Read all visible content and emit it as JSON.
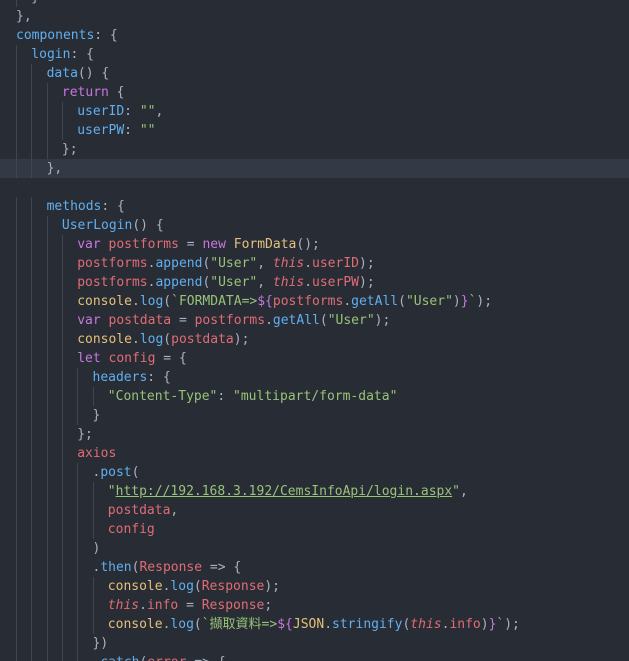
{
  "editor": {
    "lines": [
      {
        "indent": 1,
        "tokens": [
          [
            "punc",
            "}"
          ]
        ]
      },
      {
        "indent": 0,
        "tokens": [
          [
            "punc",
            "},"
          ]
        ]
      },
      {
        "indent": 0,
        "tokens": [
          [
            "prop",
            "components"
          ],
          [
            "punc",
            ": {"
          ]
        ]
      },
      {
        "indent": 1,
        "tokens": [
          [
            "prop",
            "login"
          ],
          [
            "punc",
            ": {"
          ]
        ]
      },
      {
        "indent": 2,
        "tokens": [
          [
            "fn",
            "data"
          ],
          [
            "punc",
            "() {"
          ]
        ]
      },
      {
        "indent": 3,
        "tokens": [
          [
            "kw",
            "return"
          ],
          [
            "punc",
            " {"
          ]
        ]
      },
      {
        "indent": 4,
        "tokens": [
          [
            "prop",
            "userID"
          ],
          [
            "punc",
            ": "
          ],
          [
            "str",
            "\"\""
          ],
          [
            "punc",
            ","
          ]
        ]
      },
      {
        "indent": 4,
        "tokens": [
          [
            "prop",
            "userPW"
          ],
          [
            "punc",
            ": "
          ],
          [
            "str",
            "\"\""
          ]
        ]
      },
      {
        "indent": 3,
        "tokens": [
          [
            "punc",
            "};"
          ]
        ]
      },
      {
        "indent": 2,
        "tokens": [
          [
            "punc",
            "},"
          ]
        ],
        "highlight": true
      },
      {
        "indent": 0,
        "tokens": []
      },
      {
        "indent": 2,
        "tokens": [
          [
            "prop",
            "methods"
          ],
          [
            "punc",
            ": {"
          ]
        ]
      },
      {
        "indent": 3,
        "tokens": [
          [
            "fn",
            "UserLogin"
          ],
          [
            "punc",
            "() {"
          ]
        ]
      },
      {
        "indent": 4,
        "tokens": [
          [
            "kw",
            "var"
          ],
          [
            "plain",
            " "
          ],
          [
            "var",
            "postforms"
          ],
          [
            "punc",
            " = "
          ],
          [
            "kw",
            "new"
          ],
          [
            "plain",
            " "
          ],
          [
            "cls",
            "FormData"
          ],
          [
            "punc",
            "();"
          ]
        ]
      },
      {
        "indent": 4,
        "tokens": [
          [
            "var",
            "postforms"
          ],
          [
            "punc",
            "."
          ],
          [
            "fn",
            "append"
          ],
          [
            "punc",
            "("
          ],
          [
            "str",
            "\"User\""
          ],
          [
            "punc",
            ", "
          ],
          [
            "this",
            "this"
          ],
          [
            "punc",
            "."
          ],
          [
            "var",
            "userID"
          ],
          [
            "punc",
            ");"
          ]
        ]
      },
      {
        "indent": 4,
        "tokens": [
          [
            "var",
            "postforms"
          ],
          [
            "punc",
            "."
          ],
          [
            "fn",
            "append"
          ],
          [
            "punc",
            "("
          ],
          [
            "str",
            "\"User\""
          ],
          [
            "punc",
            ", "
          ],
          [
            "this",
            "this"
          ],
          [
            "punc",
            "."
          ],
          [
            "var",
            "userPW"
          ],
          [
            "punc",
            ");"
          ]
        ]
      },
      {
        "indent": 4,
        "tokens": [
          [
            "console",
            "console"
          ],
          [
            "punc",
            "."
          ],
          [
            "fn",
            "log"
          ],
          [
            "punc",
            "("
          ],
          [
            "tpl",
            "`FORMDATA=>"
          ],
          [
            "tplx",
            "${"
          ],
          [
            "var",
            "postforms"
          ],
          [
            "punc",
            "."
          ],
          [
            "fn",
            "getAll"
          ],
          [
            "punc",
            "("
          ],
          [
            "str",
            "\"User\""
          ],
          [
            "punc",
            ")"
          ],
          [
            "tplx",
            "}"
          ],
          [
            "tpl",
            "`"
          ],
          [
            "punc",
            ");"
          ]
        ]
      },
      {
        "indent": 4,
        "tokens": [
          [
            "kw",
            "var"
          ],
          [
            "plain",
            " "
          ],
          [
            "var",
            "postdata"
          ],
          [
            "punc",
            " = "
          ],
          [
            "var",
            "postforms"
          ],
          [
            "punc",
            "."
          ],
          [
            "fn",
            "getAll"
          ],
          [
            "punc",
            "("
          ],
          [
            "str",
            "\"User\""
          ],
          [
            "punc",
            ");"
          ]
        ]
      },
      {
        "indent": 4,
        "tokens": [
          [
            "console",
            "console"
          ],
          [
            "punc",
            "."
          ],
          [
            "fn",
            "log"
          ],
          [
            "punc",
            "("
          ],
          [
            "var",
            "postdata"
          ],
          [
            "punc",
            ");"
          ]
        ]
      },
      {
        "indent": 4,
        "tokens": [
          [
            "kw",
            "let"
          ],
          [
            "plain",
            " "
          ],
          [
            "var",
            "config"
          ],
          [
            "punc",
            " = {"
          ]
        ]
      },
      {
        "indent": 5,
        "tokens": [
          [
            "prop",
            "headers"
          ],
          [
            "punc",
            ": {"
          ]
        ]
      },
      {
        "indent": 6,
        "tokens": [
          [
            "str",
            "\"Content-Type\""
          ],
          [
            "punc",
            ": "
          ],
          [
            "str",
            "\"multipart/form-data\""
          ]
        ]
      },
      {
        "indent": 5,
        "tokens": [
          [
            "punc",
            "}"
          ]
        ]
      },
      {
        "indent": 4,
        "tokens": [
          [
            "punc",
            "};"
          ]
        ]
      },
      {
        "indent": 4,
        "tokens": [
          [
            "var",
            "axios"
          ]
        ]
      },
      {
        "indent": 5,
        "tokens": [
          [
            "punc",
            "."
          ],
          [
            "fn",
            "post"
          ],
          [
            "punc",
            "("
          ]
        ]
      },
      {
        "indent": 6,
        "tokens": [
          [
            "str",
            "\""
          ],
          [
            "url",
            "http://192.168.3.192/CemsInfoApi/login.aspx"
          ],
          [
            "str",
            "\""
          ],
          [
            "punc",
            ","
          ]
        ]
      },
      {
        "indent": 6,
        "tokens": [
          [
            "var",
            "postdata"
          ],
          [
            "punc",
            ","
          ]
        ]
      },
      {
        "indent": 6,
        "tokens": [
          [
            "var",
            "config"
          ]
        ]
      },
      {
        "indent": 5,
        "tokens": [
          [
            "punc",
            ")"
          ]
        ]
      },
      {
        "indent": 5,
        "tokens": [
          [
            "punc",
            "."
          ],
          [
            "fn",
            "then"
          ],
          [
            "punc",
            "("
          ],
          [
            "var",
            "Response"
          ],
          [
            "punc",
            " => {"
          ]
        ]
      },
      {
        "indent": 6,
        "tokens": [
          [
            "console",
            "console"
          ],
          [
            "punc",
            "."
          ],
          [
            "fn",
            "log"
          ],
          [
            "punc",
            "("
          ],
          [
            "var",
            "Response"
          ],
          [
            "punc",
            ");"
          ]
        ]
      },
      {
        "indent": 6,
        "tokens": [
          [
            "this",
            "this"
          ],
          [
            "punc",
            "."
          ],
          [
            "var",
            "info"
          ],
          [
            "punc",
            " = "
          ],
          [
            "var",
            "Response"
          ],
          [
            "punc",
            ";"
          ]
        ]
      },
      {
        "indent": 6,
        "tokens": [
          [
            "console",
            "console"
          ],
          [
            "punc",
            "."
          ],
          [
            "fn",
            "log"
          ],
          [
            "punc",
            "("
          ],
          [
            "tpl",
            "`擷取資料=>"
          ],
          [
            "tplx",
            "${"
          ],
          [
            "cls",
            "JSON"
          ],
          [
            "punc",
            "."
          ],
          [
            "fn",
            "stringify"
          ],
          [
            "punc",
            "("
          ],
          [
            "this",
            "this"
          ],
          [
            "punc",
            "."
          ],
          [
            "var",
            "info"
          ],
          [
            "punc",
            ")"
          ],
          [
            "tplx",
            "}"
          ],
          [
            "tpl",
            "`"
          ],
          [
            "punc",
            ");"
          ]
        ]
      },
      {
        "indent": 5,
        "tokens": [
          [
            "punc",
            "})"
          ]
        ]
      },
      {
        "indent": 5,
        "tokens": [
          [
            "punc",
            "."
          ],
          [
            "fn",
            "catch"
          ],
          [
            "punc",
            "("
          ],
          [
            "var",
            "error"
          ],
          [
            "punc",
            " => {"
          ]
        ]
      }
    ]
  },
  "colors": {
    "background": "#282c34",
    "highlight": "#343a45",
    "keyword": "#c678dd",
    "property": "#61afef",
    "variable": "#e06c75",
    "string": "#98c379",
    "class": "#e5c07b"
  }
}
